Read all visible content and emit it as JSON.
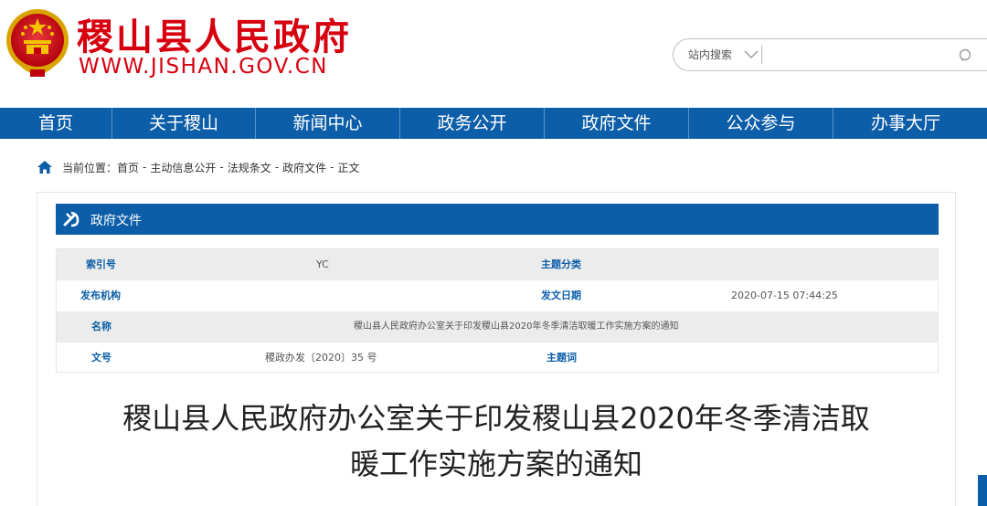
{
  "header": {
    "site_title": "稷山县人民政府",
    "site_url": "WWW.JISHAN.GOV.CN"
  },
  "search": {
    "scope_label": "站内搜索",
    "input_value": "",
    "placeholder": ""
  },
  "nav": {
    "items": [
      "首页",
      "关于稷山",
      "新闻中心",
      "政务公开",
      "政府文件",
      "公众参与",
      "办事大厅"
    ]
  },
  "breadcrumb": {
    "prefix": "当前位置：",
    "items": [
      "首页",
      "主动信息公开",
      "法规条文",
      "政府文件",
      "正文"
    ],
    "separator": "-"
  },
  "section": {
    "title": "政府文件"
  },
  "meta": {
    "index_label": "索引号",
    "index_value": "YC",
    "category_label": "主题分类",
    "category_value": "",
    "publisher_label": "发布机构",
    "publisher_value": "",
    "date_label": "发文日期",
    "date_value": "2020-07-15 07:44:25",
    "name_label": "名称",
    "name_value": "稷山县人民政府办公室关于印发稷山县2020年冬季清洁取暖工作实施方案的通知",
    "docno_label": "文号",
    "docno_value": "稷政办发〔2020〕35 号",
    "keywords_label": "主题词",
    "keywords_value": ""
  },
  "article": {
    "title_line1": "稷山县人民政府办公室关于印发稷山县2020年冬季清洁取",
    "title_line2": "暖工作实施方案的通知"
  },
  "colors": {
    "brand_red": "#d6000f",
    "nav_blue": "#0d5ea8",
    "row_shade": "#ececec"
  },
  "icons": {
    "emblem": "national-emblem-icon",
    "search": "search-icon",
    "chevron": "chevron-down-icon",
    "home": "home-icon",
    "section": "party-emblem-icon"
  }
}
